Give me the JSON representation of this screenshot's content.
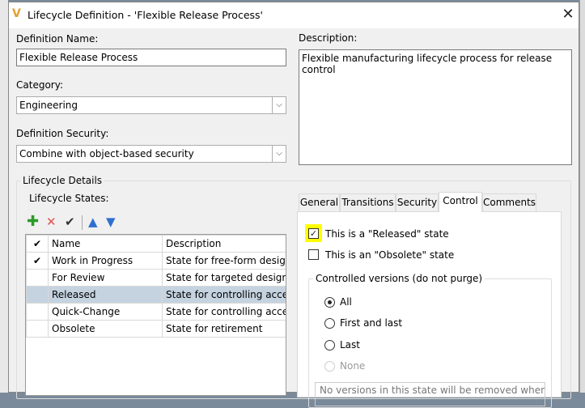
{
  "dialog": {
    "title": "Lifecycle Definition - 'Flexible Release Process'",
    "close_icon": "close-icon",
    "definition_name_label": "Definition Name:",
    "definition_name_value": "Flexible Release Process",
    "category_label": "Category:",
    "category_value": "Engineering",
    "security_label": "Definition Security:",
    "security_value": "Combine with object-based security",
    "description_label": "Description:",
    "description_value": "Flexible manufacturing lifecycle process for release control"
  },
  "details": {
    "group_label": "Lifecycle Details",
    "states_label": "Lifecycle States:",
    "toolbar": [
      "add-icon",
      "delete-icon",
      "check-icon",
      "move-up-icon",
      "move-down-icon"
    ],
    "columns": [
      "Name",
      "Description"
    ],
    "rows": [
      {
        "checked": true,
        "name": "Work in Progress",
        "description": "State for free-form design ..."
      },
      {
        "checked": false,
        "name": "For Review",
        "description": "State for targeted design r..."
      },
      {
        "checked": false,
        "name": "Released",
        "description": "State for controlling acces...",
        "selected": true
      },
      {
        "checked": false,
        "name": "Quick-Change",
        "description": "State for controlling acces..."
      },
      {
        "checked": false,
        "name": "Obsolete",
        "description": "State for retirement"
      }
    ]
  },
  "tabs": [
    "General",
    "Transitions",
    "Security",
    "Control",
    "Comments"
  ],
  "active_tab": "Control",
  "control": {
    "released_label": "This is a \"Released\" state",
    "released_checked": true,
    "obsolete_label": "This is an \"Obsolete\" state",
    "obsolete_checked": false,
    "versions_group": "Controlled versions (do not purge)",
    "options": [
      "All",
      "First and last",
      "Last",
      "None"
    ],
    "selected_option": "All",
    "note": "No versions in this state will be removed when a",
    "highlight_color": "#ffff00"
  }
}
